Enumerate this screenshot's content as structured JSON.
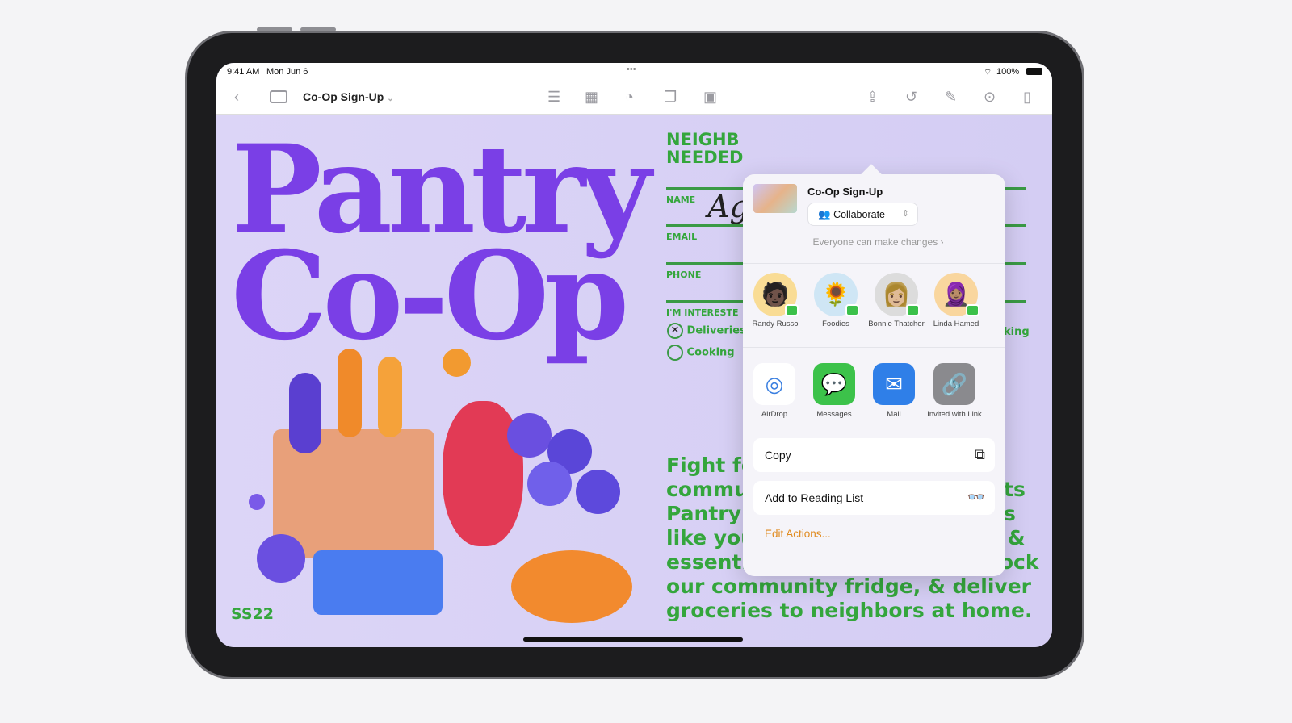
{
  "status": {
    "time": "9:41 AM",
    "date": "Mon Jun 6",
    "battery": "100%"
  },
  "toolbar": {
    "title": "Co-Op Sign-Up",
    "icons": [
      "back-icon",
      "sidebar-icon",
      "list-icon",
      "table-icon",
      "chart-icon",
      "shapes-icon",
      "media-icon",
      "share-icon",
      "undo-icon",
      "format-brush-icon",
      "more-icon",
      "document-icon"
    ]
  },
  "poster": {
    "title1": "Pantry",
    "title2": "Co-Op",
    "heading1": "NEIGHB",
    "heading2": "NEEDED",
    "fields": [
      "NAME",
      "EMAIL",
      "PHONE",
      "I'M INTERESTE"
    ],
    "options": [
      "Deliveries",
      "Cooking"
    ],
    "option_right": "king",
    "signature": "Ag",
    "body": [
      "Fight fo",
      "commu",
      "Pantry",
      "like you to shop for groceries &",
      "essential supplies, clean & stock",
      "our community fridge, & deliver",
      "groceries to neighbors at home."
    ],
    "body_right": [
      "ts",
      "s"
    ],
    "code": "SS22"
  },
  "share": {
    "title": "Co-Op Sign-Up",
    "mode": "Collaborate",
    "permission": "Everyone can make changes",
    "people": [
      {
        "name": "Randy Russo"
      },
      {
        "name": "Foodies"
      },
      {
        "name": "Bonnie Thatcher"
      },
      {
        "name": "Linda Hamed"
      }
    ],
    "apps": [
      {
        "name": "AirDrop",
        "color": "#ffffff"
      },
      {
        "name": "Messages",
        "color": "#3cc24a"
      },
      {
        "name": "Mail",
        "color": "#2f7fe8"
      },
      {
        "name": "Invited with Link",
        "color": "#8a8a8e"
      }
    ],
    "actions": [
      {
        "label": "Copy",
        "icon": "copy-icon"
      },
      {
        "label": "Add to Reading List",
        "icon": "glasses-icon"
      }
    ],
    "edit": "Edit Actions..."
  }
}
